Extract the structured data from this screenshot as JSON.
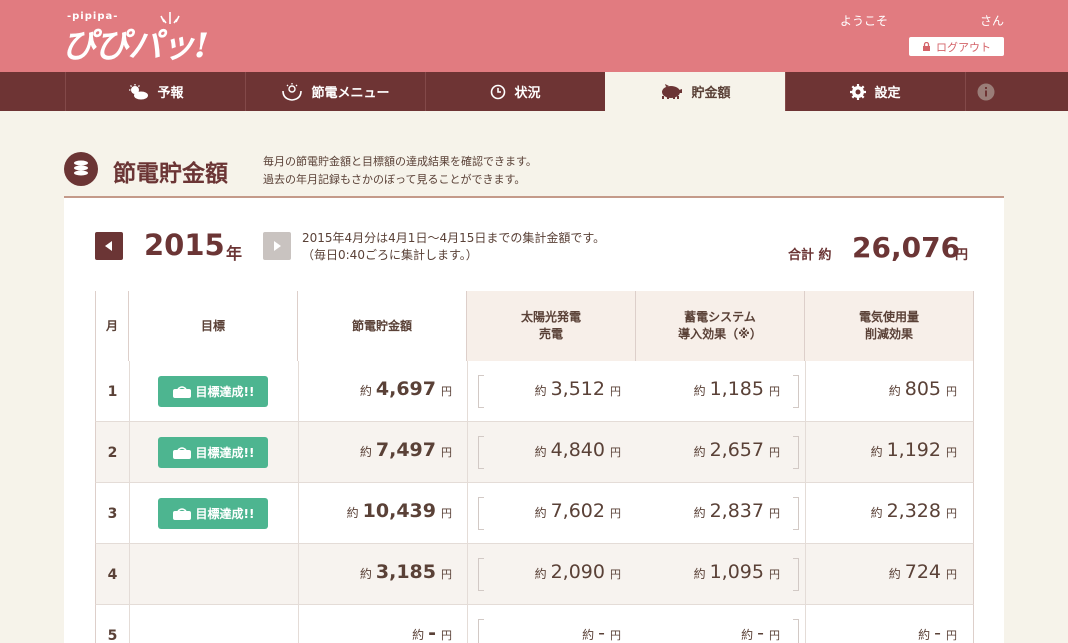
{
  "header": {
    "logo_small": "-pipipa-",
    "logo": "ぴぴパッ!",
    "welcome": "ようこそ",
    "honorific": "さん",
    "logout_label": "ログアウト"
  },
  "nav": {
    "items": [
      {
        "label": "予報",
        "icon": "weather-icon"
      },
      {
        "label": "節電メニュー",
        "icon": "hands-icon"
      },
      {
        "label": "状況",
        "icon": "clock-icon"
      },
      {
        "label": "貯金額",
        "icon": "piggy-bank-icon",
        "active": true
      },
      {
        "label": "設定",
        "icon": "gear-icon"
      }
    ],
    "info_icon": "info-icon"
  },
  "page": {
    "title": "節電貯金額",
    "desc_line1": "毎月の節電貯金額と目標額の達成結果を確認できます。",
    "desc_line2": "過去の年月記録もさかのぼって見ることができます。"
  },
  "summary": {
    "year": "2015",
    "year_unit": "年",
    "note_line1": "2015年4月分は4月1日〜4月15日までの集計金額です。",
    "note_line2": "（毎日0:40ごろに集計します。）",
    "total_label": "合計 約",
    "total_value": "26,076",
    "total_unit": "円"
  },
  "table": {
    "headers": {
      "month": "月",
      "goal": "目標",
      "savings": "節電貯金額",
      "solar_l1": "太陽光発電",
      "solar_l2": "売電",
      "storage_l1": "蓄電システム",
      "storage_l2": "導入効果（※）",
      "usage_l1": "電気使用量",
      "usage_l2": "削減効果"
    },
    "prefix": "約",
    "unit": "円",
    "badge_label": "目標達成!!",
    "rows": [
      {
        "month": "1",
        "achieved": true,
        "savings": "4,697",
        "solar": "3,512",
        "storage": "1,185",
        "usage": "805"
      },
      {
        "month": "2",
        "achieved": true,
        "savings": "7,497",
        "solar": "4,840",
        "storage": "2,657",
        "usage": "1,192"
      },
      {
        "month": "3",
        "achieved": true,
        "savings": "10,439",
        "solar": "7,602",
        "storage": "2,837",
        "usage": "2,328"
      },
      {
        "month": "4",
        "achieved": false,
        "savings": "3,185",
        "solar": "2,090",
        "storage": "1,095",
        "usage": "724"
      },
      {
        "month": "5",
        "achieved": false,
        "savings": "-",
        "solar": "-",
        "storage": "-",
        "usage": "-"
      }
    ]
  },
  "colors": {
    "header_bg": "#e17b80",
    "nav_bg": "#6e3434",
    "accent": "#6b3535",
    "badge_green": "#4db590",
    "page_bg": "#f6f3ea"
  }
}
